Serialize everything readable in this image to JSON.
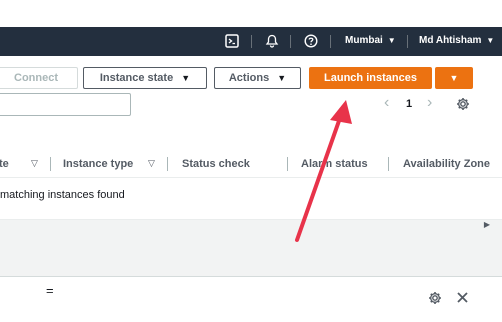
{
  "topnav": {
    "terminal_icon": "terminal-icon",
    "bell_icon": "bell-icon",
    "help_icon": "help-icon",
    "region": "Mumbai",
    "user": "Md Ahtisham"
  },
  "toolbar": {
    "connect_label": "Connect",
    "instance_state_label": "Instance state",
    "actions_label": "Actions",
    "launch_label": "Launch instances"
  },
  "pagination": {
    "page": "1"
  },
  "table": {
    "columns": [
      "te",
      "Instance type",
      "Status check",
      "Alarm status",
      "Availability Zone"
    ],
    "empty_message": "matching instances found"
  },
  "colors": {
    "nav_bg": "#232f3e",
    "primary": "#ec7211",
    "annotation_arrow": "#e8334a"
  }
}
